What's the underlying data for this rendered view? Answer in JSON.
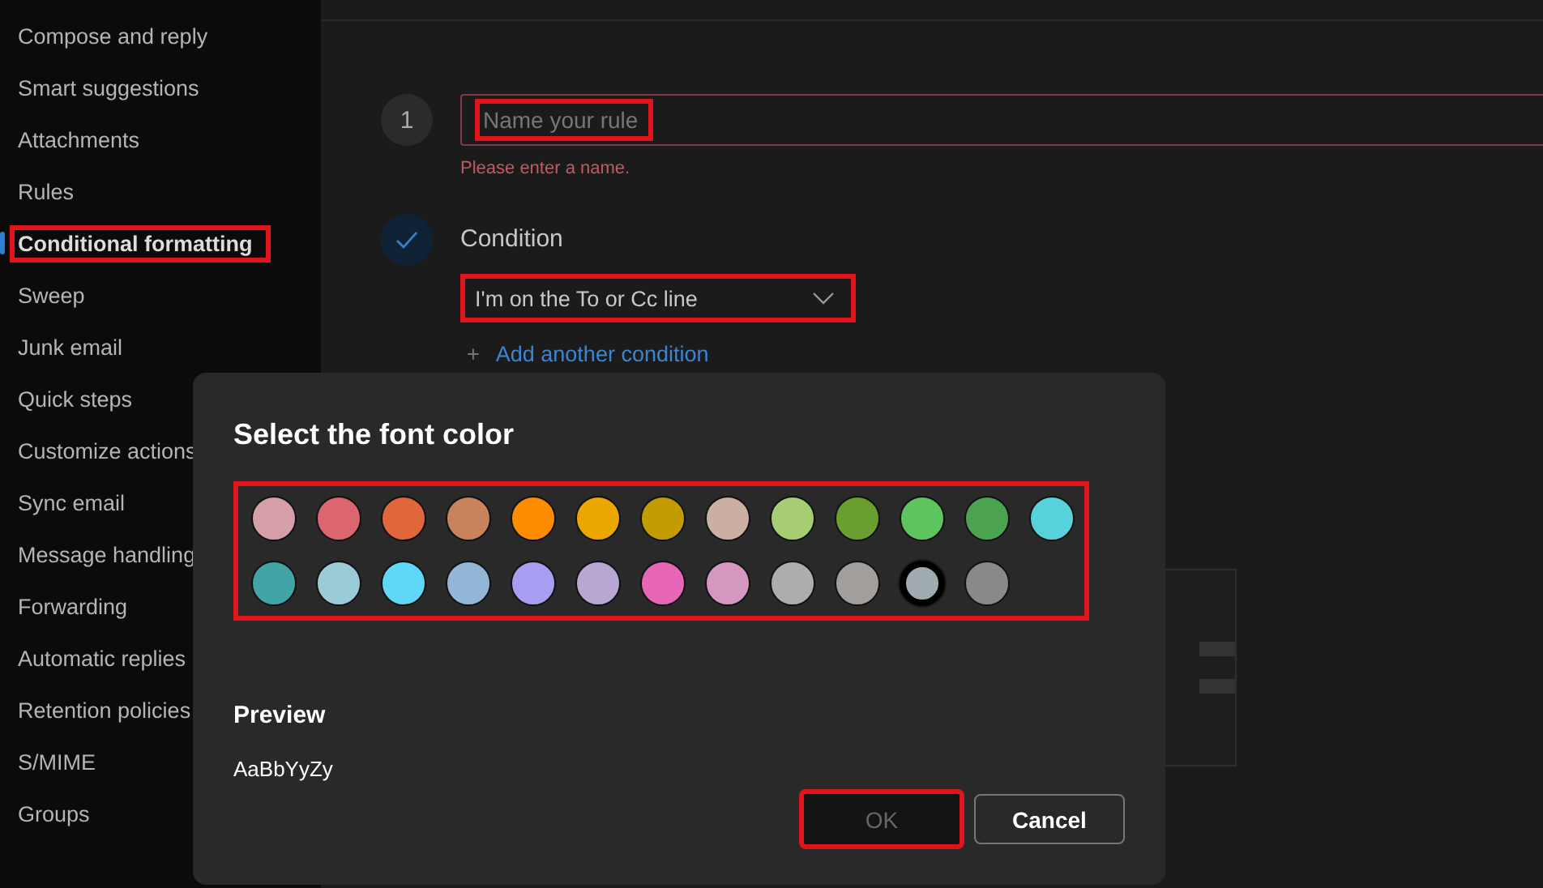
{
  "sidebar": {
    "items": [
      {
        "label": "Compose and reply",
        "selected": false,
        "highlighted": false
      },
      {
        "label": "Smart suggestions",
        "selected": false,
        "highlighted": false
      },
      {
        "label": "Attachments",
        "selected": false,
        "highlighted": false
      },
      {
        "label": "Rules",
        "selected": false,
        "highlighted": false
      },
      {
        "label": "Conditional formatting",
        "selected": true,
        "highlighted": true
      },
      {
        "label": "Sweep",
        "selected": false,
        "highlighted": false
      },
      {
        "label": "Junk email",
        "selected": false,
        "highlighted": false
      },
      {
        "label": "Quick steps",
        "selected": false,
        "highlighted": false
      },
      {
        "label": "Customize actions",
        "selected": false,
        "highlighted": false
      },
      {
        "label": "Sync email",
        "selected": false,
        "highlighted": false
      },
      {
        "label": "Message handling",
        "selected": false,
        "highlighted": false
      },
      {
        "label": "Forwarding",
        "selected": false,
        "highlighted": false
      },
      {
        "label": "Automatic replies",
        "selected": false,
        "highlighted": false
      },
      {
        "label": "Retention policies",
        "selected": false,
        "highlighted": false
      },
      {
        "label": "S/MIME",
        "selected": false,
        "highlighted": false
      },
      {
        "label": "Groups",
        "selected": false,
        "highlighted": false
      }
    ]
  },
  "rule_form": {
    "step_number": "1",
    "name_field": {
      "placeholder": "Name your rule",
      "highlighted": true
    },
    "error": "Please enter a name.",
    "condition": {
      "label": "Condition",
      "done": true,
      "dropdown": {
        "value": "I'm on the To or Cc line",
        "highlighted": true
      },
      "add_icon": "+",
      "add_link": "Add another condition"
    }
  },
  "dialog": {
    "title": "Select the font color",
    "grid_highlighted": true,
    "swatches": [
      {
        "color": "#d59ea8",
        "selected": false
      },
      {
        "color": "#dc6670",
        "selected": false
      },
      {
        "color": "#e0663c",
        "selected": false
      },
      {
        "color": "#c8825c",
        "selected": false
      },
      {
        "color": "#fd8c00",
        "selected": false
      },
      {
        "color": "#eba600",
        "selected": false
      },
      {
        "color": "#c29c00",
        "selected": false
      },
      {
        "color": "#cbafa2",
        "selected": false
      },
      {
        "color": "#a7cd72",
        "selected": false
      },
      {
        "color": "#6a9e2e",
        "selected": false
      },
      {
        "color": "#5ec45d",
        "selected": false
      },
      {
        "color": "#4ba24f",
        "selected": false
      },
      {
        "color": "#57d2da",
        "selected": false
      },
      {
        "color": "#43a4a7",
        "selected": false
      },
      {
        "color": "#9ccbd8",
        "selected": false
      },
      {
        "color": "#5fd8f8",
        "selected": false
      },
      {
        "color": "#92b6d6",
        "selected": false
      },
      {
        "color": "#a89ef1",
        "selected": false
      },
      {
        "color": "#b8a6d3",
        "selected": false
      },
      {
        "color": "#e766b8",
        "selected": false
      },
      {
        "color": "#d596c0",
        "selected": false
      },
      {
        "color": "#adadad",
        "selected": false
      },
      {
        "color": "#a19e9c",
        "selected": false
      },
      {
        "color": "#a1acb0",
        "selected": true
      },
      {
        "color": "#898989",
        "selected": false
      }
    ],
    "preview_label": "Preview",
    "preview_text": "AaBbYyZy",
    "buttons": [
      {
        "label": "OK",
        "kind": "primary",
        "disabled": true,
        "highlighted": true
      },
      {
        "label": "Cancel",
        "kind": "secondary",
        "disabled": false,
        "highlighted": false
      }
    ]
  }
}
